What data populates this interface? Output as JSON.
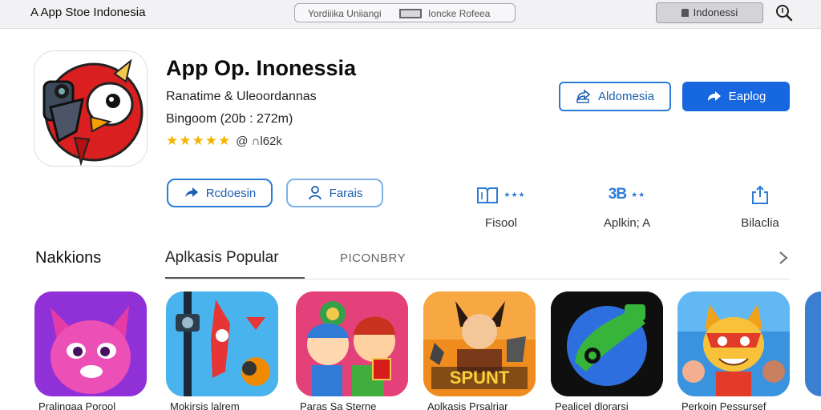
{
  "topbar": {
    "brand": "A App Stoe Indonesia",
    "address_left": "Yordiiika Uniiangi",
    "address_right": "Ioncke Rofeea",
    "region": "Indonessi",
    "search_icon": "search-icon"
  },
  "app": {
    "title": "App Op. Inonessia",
    "developer": "Ranatime & Uleoordannas",
    "size": "Bingoom (20b : 272m)",
    "stars": "★★★★★",
    "rating_text": "@ ∩l62k",
    "icon": "cartoon-bird-icon"
  },
  "buttons": {
    "secondary": "Aldomesia",
    "primary": "Eaplog",
    "share_label": "Rcdoesin",
    "person_label": "Farais"
  },
  "info": [
    {
      "icon": "book-icon",
      "extra": "★★★",
      "label": "Fisool"
    },
    {
      "icon": "3b-badge",
      "glyph": "3B",
      "extra": "★★",
      "label": "Aplkin; A"
    },
    {
      "icon": "share-icon",
      "label": "Bilaclia"
    }
  ],
  "tabs": {
    "section_title": "Nakkions",
    "active": "Aplkasis Popular",
    "inactive": "PICONBRY"
  },
  "tiles": [
    {
      "label": "Pralingaa Porool",
      "icon": "pink-cat-icon"
    },
    {
      "label": "Mokirsis lalrem",
      "icon": "action-sport-icon"
    },
    {
      "label": "Paras Sa Sterne",
      "icon": "cartoon-kids-icon"
    },
    {
      "label": "Aplkasis Prsalriar",
      "icon": "spunt-game-icon"
    },
    {
      "label": "Pealicel dlorarsi",
      "icon": "green-messenger-icon"
    },
    {
      "label": "Perkoin Pessursef",
      "icon": "hero-cat-icon"
    }
  ],
  "colors": {
    "accent": "#1767e0",
    "outline": "#2b7cd8",
    "star": "#f5b301"
  }
}
